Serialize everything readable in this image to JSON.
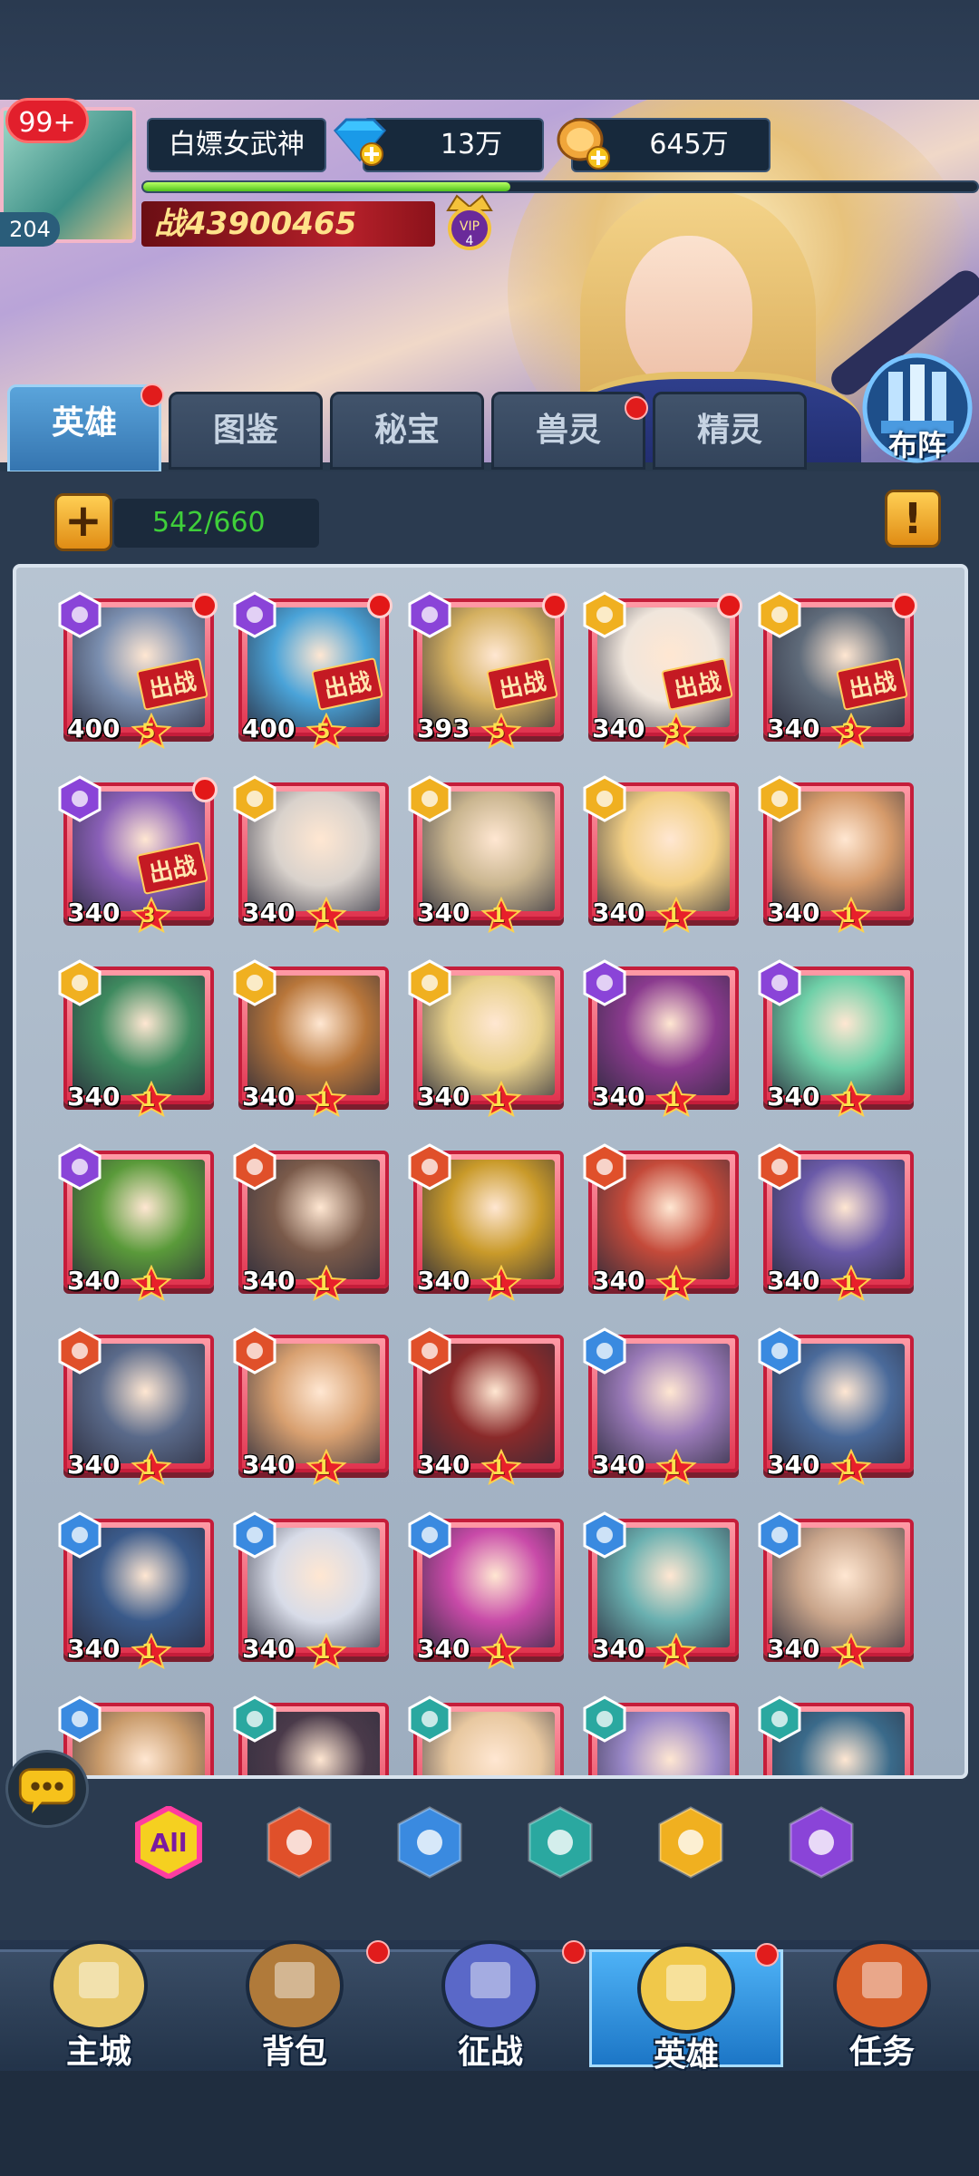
{
  "player": {
    "notification_count": "99+",
    "level": "204",
    "name": "白嫖女武神",
    "gems": "13万",
    "coins": "645万",
    "xp_progress": 0.44,
    "power_prefix": "战",
    "power": "43900465",
    "vip_label": "VIP",
    "vip_level": "4"
  },
  "tabs": [
    {
      "label": "英雄",
      "active": true,
      "dot": true
    },
    {
      "label": "图鉴",
      "active": false,
      "dot": false
    },
    {
      "label": "秘宝",
      "active": false,
      "dot": false
    },
    {
      "label": "兽灵",
      "active": false,
      "dot": true
    },
    {
      "label": "精灵",
      "active": false,
      "dot": false
    }
  ],
  "formation_label": "布阵",
  "hero_count": "542/660",
  "deploy_label": "出战",
  "heroes": [
    {
      "level": "400",
      "stars": "5",
      "faction": "purple",
      "deployed": true,
      "dot": true,
      "hue": "#7b8fb0"
    },
    {
      "level": "400",
      "stars": "5",
      "faction": "purple",
      "deployed": true,
      "dot": true,
      "hue": "#4aa3d8"
    },
    {
      "level": "393",
      "stars": "5",
      "faction": "purple",
      "deployed": true,
      "dot": true,
      "hue": "#d4b060"
    },
    {
      "level": "340",
      "stars": "3",
      "faction": "gold",
      "deployed": true,
      "dot": true,
      "hue": "#f0e6dc"
    },
    {
      "level": "340",
      "stars": "3",
      "faction": "gold",
      "deployed": true,
      "dot": true,
      "hue": "#5f6b7a"
    },
    {
      "level": "340",
      "stars": "3",
      "faction": "purple",
      "deployed": true,
      "dot": true,
      "hue": "#8a60b8"
    },
    {
      "level": "340",
      "stars": "1",
      "faction": "gold",
      "deployed": false,
      "dot": false,
      "hue": "#d9d2cc"
    },
    {
      "level": "340",
      "stars": "1",
      "faction": "gold",
      "deployed": false,
      "dot": false,
      "hue": "#c9b58f"
    },
    {
      "level": "340",
      "stars": "1",
      "faction": "gold",
      "deployed": false,
      "dot": false,
      "hue": "#f2cf84"
    },
    {
      "level": "340",
      "stars": "1",
      "faction": "gold",
      "deployed": false,
      "dot": false,
      "hue": "#d59a6a"
    },
    {
      "level": "340",
      "stars": "1",
      "faction": "gold",
      "deployed": false,
      "dot": false,
      "hue": "#3e8a5f"
    },
    {
      "level": "340",
      "stars": "1",
      "faction": "gold",
      "deployed": false,
      "dot": false,
      "hue": "#b8763a"
    },
    {
      "level": "340",
      "stars": "1",
      "faction": "gold",
      "deployed": false,
      "dot": false,
      "hue": "#e8d08a"
    },
    {
      "level": "340",
      "stars": "1",
      "faction": "purple",
      "deployed": false,
      "dot": false,
      "hue": "#8a3a8e"
    },
    {
      "level": "340",
      "stars": "1",
      "faction": "purple",
      "deployed": false,
      "dot": false,
      "hue": "#6fd0a8"
    },
    {
      "level": "340",
      "stars": "1",
      "faction": "purple",
      "deployed": false,
      "dot": false,
      "hue": "#5a9a3a"
    },
    {
      "level": "340",
      "stars": "1",
      "faction": "orange",
      "deployed": false,
      "dot": false,
      "hue": "#7a5a4a"
    },
    {
      "level": "340",
      "stars": "1",
      "faction": "orange",
      "deployed": false,
      "dot": false,
      "hue": "#c99a2a"
    },
    {
      "level": "340",
      "stars": "1",
      "faction": "orange",
      "deployed": false,
      "dot": false,
      "hue": "#c44a3a"
    },
    {
      "level": "340",
      "stars": "1",
      "faction": "orange",
      "deployed": false,
      "dot": false,
      "hue": "#6a5aa8"
    },
    {
      "level": "340",
      "stars": "1",
      "faction": "orange",
      "deployed": false,
      "dot": false,
      "hue": "#5a6a8a"
    },
    {
      "level": "340",
      "stars": "1",
      "faction": "orange",
      "deployed": false,
      "dot": false,
      "hue": "#d8a070"
    },
    {
      "level": "340",
      "stars": "1",
      "faction": "orange",
      "deployed": false,
      "dot": false,
      "hue": "#8a2a2a"
    },
    {
      "level": "340",
      "stars": "1",
      "faction": "blue",
      "deployed": false,
      "dot": false,
      "hue": "#9a7ab8"
    },
    {
      "level": "340",
      "stars": "1",
      "faction": "blue",
      "deployed": false,
      "dot": false,
      "hue": "#4a6a9a"
    },
    {
      "level": "340",
      "stars": "1",
      "faction": "blue",
      "deployed": false,
      "dot": false,
      "hue": "#3a5a8a"
    },
    {
      "level": "340",
      "stars": "1",
      "faction": "blue",
      "deployed": false,
      "dot": false,
      "hue": "#d8dce8"
    },
    {
      "level": "340",
      "stars": "1",
      "faction": "blue",
      "deployed": false,
      "dot": false,
      "hue": "#c84aa8"
    },
    {
      "level": "340",
      "stars": "1",
      "faction": "blue",
      "deployed": false,
      "dot": false,
      "hue": "#6ab0b0"
    },
    {
      "level": "340",
      "stars": "1",
      "faction": "blue",
      "deployed": false,
      "dot": false,
      "hue": "#c8a48a"
    },
    {
      "level": "",
      "stars": "",
      "faction": "blue",
      "deployed": false,
      "dot": false,
      "hue": "#c89a6a"
    },
    {
      "level": "",
      "stars": "",
      "faction": "teal",
      "deployed": false,
      "dot": false,
      "hue": "#4a3a4a"
    },
    {
      "level": "",
      "stars": "",
      "faction": "teal",
      "deployed": false,
      "dot": false,
      "hue": "#e8c8a0"
    },
    {
      "level": "",
      "stars": "",
      "faction": "teal",
      "deployed": false,
      "dot": false,
      "hue": "#9a88c8"
    },
    {
      "level": "",
      "stars": "",
      "faction": "teal",
      "deployed": false,
      "dot": false,
      "hue": "#3a6a8a"
    }
  ],
  "filters": [
    {
      "name": "all",
      "label": "All",
      "color": "#f5d020"
    },
    {
      "name": "orange",
      "label": "",
      "color": "#e0502a"
    },
    {
      "name": "blue",
      "label": "",
      "color": "#3a8ae0"
    },
    {
      "name": "teal",
      "label": "",
      "color": "#2aa8a0"
    },
    {
      "name": "gold",
      "label": "",
      "color": "#f0b020"
    },
    {
      "name": "purple",
      "label": "",
      "color": "#8a44d8"
    }
  ],
  "faction_colors": {
    "purple": "#8a44d8",
    "gold": "#f0b020",
    "orange": "#e0502a",
    "blue": "#3a8ae0",
    "teal": "#2aa8a0"
  },
  "nav": [
    {
      "label": "主城",
      "dot": false,
      "active": false,
      "icon": "castle-icon"
    },
    {
      "label": "背包",
      "dot": true,
      "active": false,
      "icon": "chest-icon"
    },
    {
      "label": "征战",
      "dot": true,
      "active": false,
      "icon": "portal-icon"
    },
    {
      "label": "英雄",
      "dot": true,
      "active": true,
      "icon": "helmet-icon"
    },
    {
      "label": "任务",
      "dot": false,
      "active": false,
      "icon": "scroll-icon"
    }
  ]
}
